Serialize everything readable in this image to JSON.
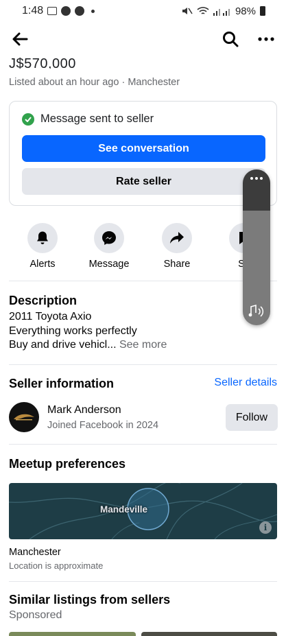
{
  "status_bar": {
    "time": "1:48",
    "battery": "98%"
  },
  "listing": {
    "price": "J$570,000",
    "listed_info": "Listed about an hour ago · Manchester"
  },
  "message_card": {
    "sent_text": "Message sent to seller",
    "see_conversation": "See conversation",
    "rate_seller": "Rate seller"
  },
  "actions": [
    {
      "label": "Alerts",
      "icon": "bell-icon"
    },
    {
      "label": "Message",
      "icon": "messenger-icon"
    },
    {
      "label": "Share",
      "icon": "share-icon"
    },
    {
      "label": "Sa",
      "icon": "save-icon"
    }
  ],
  "description": {
    "title": "Description",
    "line1": "2011 Toyota Axio",
    "line2": "Everything works perfectly",
    "line3": "Buy and drive vehicl...",
    "see_more": "See more"
  },
  "seller": {
    "title": "Seller information",
    "details_link": "Seller details",
    "name": "Mark Anderson",
    "joined": "Joined Facebook in 2024",
    "follow": "Follow"
  },
  "meetup": {
    "title": "Meetup preferences",
    "map_label": "Mandeville",
    "map_info": "i",
    "location": "Manchester",
    "note": "Location is approximate"
  },
  "similar": {
    "title": "Similar listings from sellers",
    "sponsored": "Sponsored"
  },
  "colors": {
    "primary": "#0866ff",
    "secondary_bg": "#e4e6eb",
    "success": "#31a24c",
    "map_bg": "#1e3d46"
  }
}
